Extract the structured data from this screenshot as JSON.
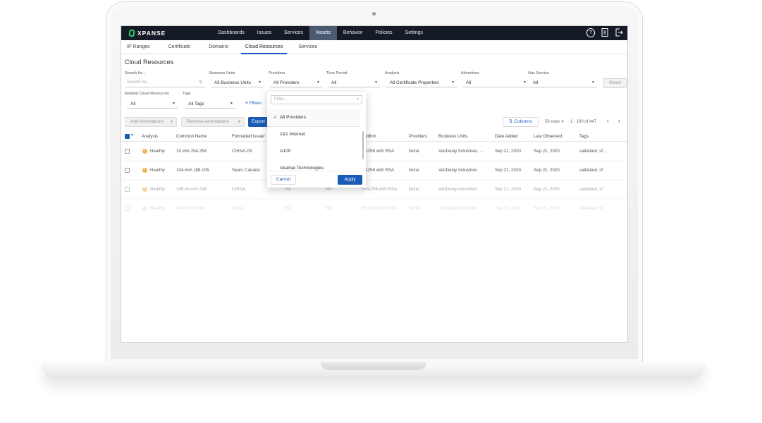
{
  "nav": {
    "logo": "XPANSE",
    "items": [
      {
        "label": "Dashboards"
      },
      {
        "label": "Issues"
      },
      {
        "label": "Services"
      },
      {
        "label": "Assets",
        "active": true
      },
      {
        "label": "Behavior"
      },
      {
        "label": "Policies"
      },
      {
        "label": "Settings"
      }
    ],
    "icons": [
      "help-icon",
      "document-icon",
      "logout-icon"
    ]
  },
  "subnav": {
    "items": [
      {
        "label": "IP Ranges"
      },
      {
        "label": "Certificate"
      },
      {
        "label": "Domains"
      },
      {
        "label": "Cloud Resources",
        "active": true
      },
      {
        "label": "Services"
      }
    ]
  },
  "page": {
    "title": "Cloud Resources"
  },
  "filters": {
    "search": {
      "label": "Search for...",
      "placeholder": "Search for..."
    },
    "business_units": {
      "label": "Business Units",
      "value": "All Business Units"
    },
    "providers": {
      "label": "Providers",
      "value": "All Providers"
    },
    "time_period": {
      "label": "Time Period",
      "value": "All"
    },
    "analysis": {
      "label": "Analysis",
      "value": "All Certificate Properties"
    },
    "advertises": {
      "label": "Advertises",
      "value": "All"
    },
    "has_service": {
      "label": "Has Service",
      "value": "All"
    },
    "reset": "Reset",
    "related_cloud_resources": {
      "label": "Related Cloud Resources",
      "value": "All"
    },
    "tags": {
      "label": "Tags",
      "value": "All Tags"
    },
    "filters_link": "Filters"
  },
  "toolbar": {
    "add_annotations": "Add Annotations",
    "remove_annotations": "Remove Annotations",
    "export": "Export",
    "columns": "Columns",
    "rows": "50 rows",
    "range": "1 - 100 of 447"
  },
  "table": {
    "headers": [
      "Analysis",
      "Common Name",
      "Formatted Issuer",
      "gorithm",
      "Providers",
      "Business Units",
      "Date Added",
      "Last Observed",
      "Tags"
    ],
    "rows": [
      {
        "analysis": "Healthy",
        "common_name": "10.###.254.254",
        "issuer": "CHINA-ISI",
        "algorithm": "HA256 with RSA",
        "providers": "None",
        "business_units": "VanDelay Industries, ...",
        "date_added": "Sep 21, 2020",
        "last_observed": "Sep 21, 2020",
        "tags": "validated, sf..."
      },
      {
        "analysis": "Healthy",
        "common_name": "104.###.188.105",
        "issuer": "Sears Canada",
        "algorithm": "HA256 with RSA",
        "providers": "None",
        "business_units": "VanDelay Industries",
        "date_added": "Sep 21, 2020",
        "last_observed": "Sep 21, 2020",
        "tags": "validated, sf"
      },
      {
        "analysis": "Healthy",
        "common_name": "106.##.###.234",
        "issuer": "CHINA",
        "col4": "No",
        "col5": "No",
        "algorithm": "SHA256 with RSA",
        "providers": "None",
        "business_units": "VanDelay Industries",
        "date_added": "Sep 21, 2020",
        "last_observed": "Sep 21, 2020",
        "tags": "validated, sf"
      },
      {
        "analysis": "Healthy",
        "common_name": "###.##.###.##",
        "issuer": "China",
        "col4": "No",
        "col5": "No",
        "algorithm": "SHA256 with RSA",
        "providers": "None",
        "business_units": "VanDelay Industries",
        "date_added": "Sep 21, 2020",
        "last_observed": "Sep 21, 2020",
        "tags": "validated, sf"
      }
    ]
  },
  "providers_dropdown": {
    "filter_placeholder": "Filter...",
    "options": [
      {
        "label": "All Providers",
        "selected": true
      },
      {
        "label": "1&1 Internet"
      },
      {
        "label": "A100"
      },
      {
        "label": "Akamai Technologies"
      }
    ],
    "cancel": "Cancel",
    "apply": "Apply"
  }
}
